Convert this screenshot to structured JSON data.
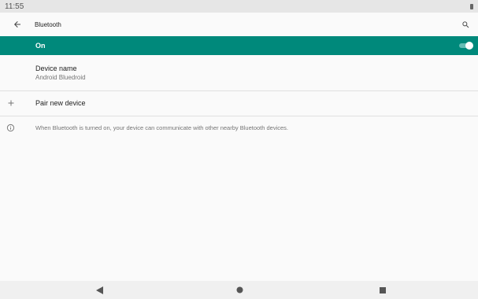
{
  "status_bar": {
    "time": "11:55",
    "battery_icon": "battery-icon"
  },
  "app_bar": {
    "title": "Bluetooth",
    "back_icon": "arrow-back-icon",
    "search_icon": "search-icon"
  },
  "master_switch": {
    "label": "On",
    "checked": true,
    "accent_color": "#00897b"
  },
  "preferences": {
    "device_name": {
      "title": "Device name",
      "summary": "Android Bluedroid"
    },
    "pair_new_device": {
      "title": "Pair new device",
      "icon": "plus-icon"
    }
  },
  "footer": {
    "icon": "info-icon",
    "text": "When Bluetooth is turned on, your device can communicate with other nearby Bluetooth devices."
  },
  "nav_bar": {
    "back_icon": "nav-back-icon",
    "home_icon": "nav-home-icon",
    "recents_icon": "nav-recents-icon"
  }
}
